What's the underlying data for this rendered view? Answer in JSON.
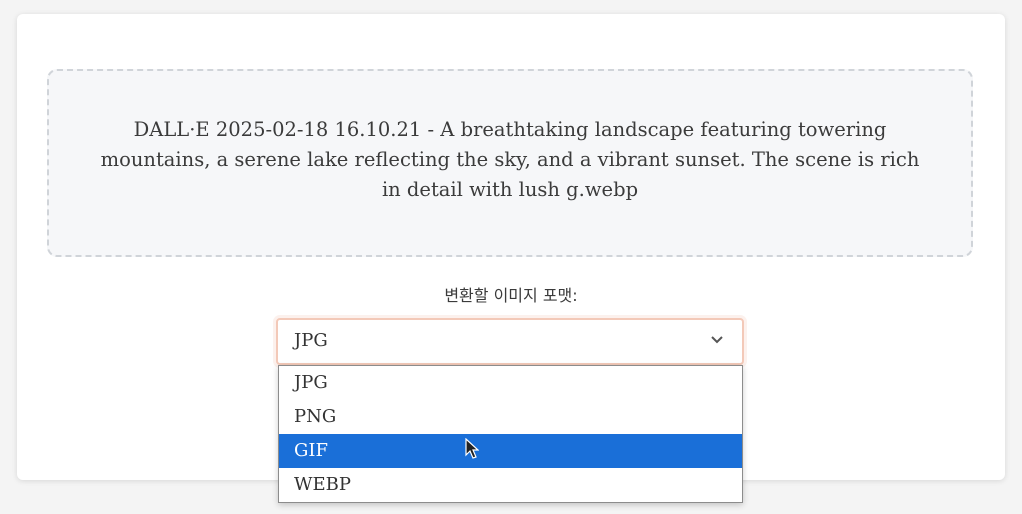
{
  "upload": {
    "filename": "DALL·E 2025-02-18 16.10.21 - A breathtaking landscape featuring towering mountains, a serene lake reflecting the sky, and a vibrant sunset. The scene is rich in detail with lush g.webp"
  },
  "format": {
    "label": "변환할 이미지 포맷:",
    "selected_value": "JPG",
    "options": [
      "JPG",
      "PNG",
      "GIF",
      "WEBP"
    ],
    "highlighted_option": "GIF"
  },
  "colors": {
    "highlight": "#1a6fd8",
    "select_focus_border": "#f3c9b8"
  },
  "icons": {
    "select_arrow": "chevron-down-icon",
    "cursor": "mouse-pointer-icon"
  }
}
